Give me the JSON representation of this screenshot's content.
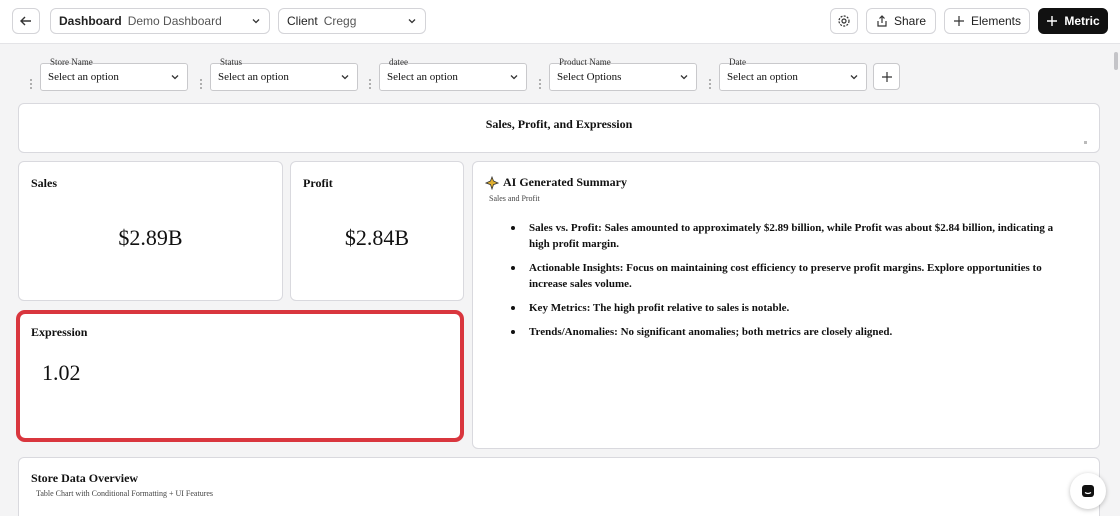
{
  "header": {
    "dashboard_label": "Dashboard",
    "dashboard_value": "Demo Dashboard",
    "client_label": "Client",
    "client_value": "Cregg",
    "share_label": "Share",
    "elements_label": "Elements",
    "metric_label": "Metric"
  },
  "filters": [
    {
      "label": "Store Name",
      "value": "Select an option"
    },
    {
      "label": "Status",
      "value": "Select an option"
    },
    {
      "label": "datee",
      "value": "Select an option"
    },
    {
      "label": "Product Name",
      "value": "Select Options"
    },
    {
      "label": "Date",
      "value": "Select an option"
    }
  ],
  "title_card": {
    "title": "Sales, Profit, and Expression"
  },
  "cards": {
    "sales": {
      "title": "Sales",
      "value": "$2.89B"
    },
    "profit": {
      "title": "Profit",
      "value": "$2.84B"
    },
    "expression": {
      "title": "Expression",
      "value": "1.02"
    }
  },
  "ai_summary": {
    "title": "AI Generated Summary",
    "subtitle": "Sales and Profit",
    "bullets": [
      "Sales vs. Profit: Sales amounted to approximately $2.89 billion, while Profit was about $2.84 billion, indicating a high profit margin.",
      "Actionable Insights: Focus on maintaining cost efficiency to preserve profit margins. Explore opportunities to increase sales volume.",
      "Key Metrics: The high profit relative to sales is notable.",
      "Trends/Anomalies: No significant anomalies; both metrics are closely aligned."
    ]
  },
  "store_overview": {
    "title": "Store Data Overview",
    "subtitle": "Table Chart with Conditional Formatting + UI Features"
  },
  "colors": {
    "highlight": "#d9363e",
    "primary_button": "#111111"
  },
  "icons": [
    "back-arrow-icon",
    "chevron-down-icon",
    "gear-icon",
    "share-icon",
    "plus-icon",
    "sparkle-icon",
    "chat-icon"
  ]
}
